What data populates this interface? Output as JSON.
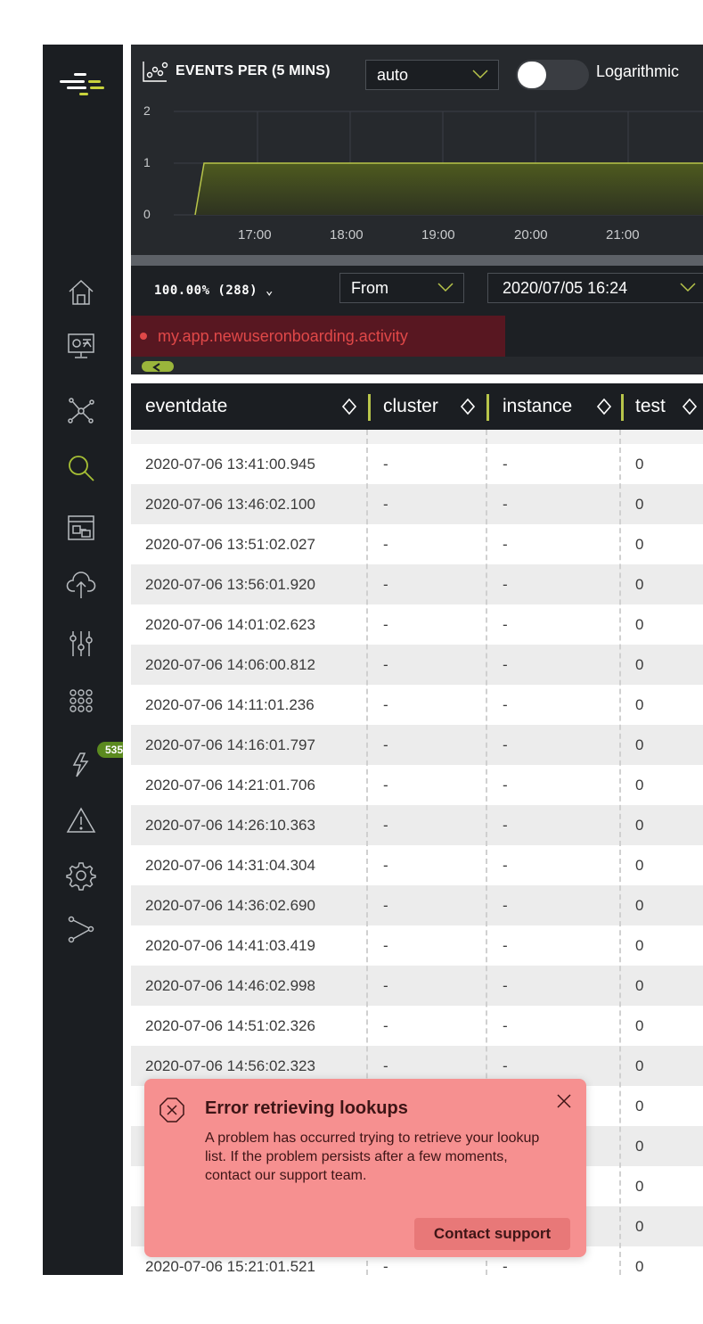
{
  "sidebar": {
    "logo": "logo-icon",
    "items": [
      {
        "name": "home",
        "icon": "home-icon"
      },
      {
        "name": "dashboard",
        "icon": "monitor-icon"
      },
      {
        "name": "network",
        "icon": "network-icon"
      },
      {
        "name": "search",
        "icon": "search-icon",
        "active": true
      },
      {
        "name": "layout",
        "icon": "window-icon"
      },
      {
        "name": "upload",
        "icon": "cloud-upload-icon"
      },
      {
        "name": "settings-sliders",
        "icon": "sliders-icon"
      },
      {
        "name": "apps",
        "icon": "grid-icon"
      },
      {
        "name": "alerts",
        "icon": "lightning-icon",
        "badge": "535"
      },
      {
        "name": "warning",
        "icon": "warning-icon"
      },
      {
        "name": "admin",
        "icon": "gear-icon"
      },
      {
        "name": "flows",
        "icon": "connector-icon"
      }
    ]
  },
  "chart": {
    "title": "EVENTS PER (5 MINS)",
    "interval_select": "auto",
    "logarithmic_label": "Logarithmic",
    "logarithmic_on": false,
    "y_ticks": [
      "2",
      "1",
      "0"
    ],
    "x_ticks": [
      "17:00",
      "18:00",
      "19:00",
      "20:00",
      "21:00"
    ],
    "accent": "#b8c54a"
  },
  "chart_data": {
    "type": "area",
    "x": [
      "16:24",
      "16:29",
      "17:00",
      "18:00",
      "19:00",
      "20:00",
      "21:00",
      "21:30"
    ],
    "values": [
      0,
      1,
      1,
      1,
      1,
      1,
      1,
      1
    ],
    "ylim": [
      0,
      2
    ],
    "title": "EVENTS PER (5 MINS)"
  },
  "filter": {
    "percentage": "100.00% (288)",
    "from_label": "From",
    "from_value": "2020/07/05 16:24"
  },
  "source_tab": "my.app.newuseronboarding.activity",
  "table": {
    "columns": [
      "eventdate",
      "cluster",
      "instance",
      "test"
    ],
    "rows": [
      [
        "2020-07-06 13:41:00.945",
        "-",
        "-",
        "0"
      ],
      [
        "2020-07-06 13:46:02.100",
        "-",
        "-",
        "0"
      ],
      [
        "2020-07-06 13:51:02.027",
        "-",
        "-",
        "0"
      ],
      [
        "2020-07-06 13:56:01.920",
        "-",
        "-",
        "0"
      ],
      [
        "2020-07-06 14:01:02.623",
        "-",
        "-",
        "0"
      ],
      [
        "2020-07-06 14:06:00.812",
        "-",
        "-",
        "0"
      ],
      [
        "2020-07-06 14:11:01.236",
        "-",
        "-",
        "0"
      ],
      [
        "2020-07-06 14:16:01.797",
        "-",
        "-",
        "0"
      ],
      [
        "2020-07-06 14:21:01.706",
        "-",
        "-",
        "0"
      ],
      [
        "2020-07-06 14:26:10.363",
        "-",
        "-",
        "0"
      ],
      [
        "2020-07-06 14:31:04.304",
        "-",
        "-",
        "0"
      ],
      [
        "2020-07-06 14:36:02.690",
        "-",
        "-",
        "0"
      ],
      [
        "2020-07-06 14:41:03.419",
        "-",
        "-",
        "0"
      ],
      [
        "2020-07-06 14:46:02.998",
        "-",
        "-",
        "0"
      ],
      [
        "2020-07-06 14:51:02.326",
        "-",
        "-",
        "0"
      ],
      [
        "2020-07-06 14:56:02.323",
        "-",
        "-",
        "0"
      ],
      [
        "",
        "",
        "",
        "0"
      ],
      [
        "",
        "",
        "",
        "0"
      ],
      [
        "",
        "",
        "",
        "0"
      ],
      [
        "",
        "",
        "",
        "0"
      ],
      [
        "2020-07-06 15:21:01.521",
        "-",
        "-",
        "0"
      ]
    ]
  },
  "toast": {
    "title": "Error retrieving lookups",
    "body": "A problem has occurred trying to retrieve your lookup list. If the problem persists after a few moments, contact our support team.",
    "button": "Contact support",
    "color": "#f69090"
  }
}
